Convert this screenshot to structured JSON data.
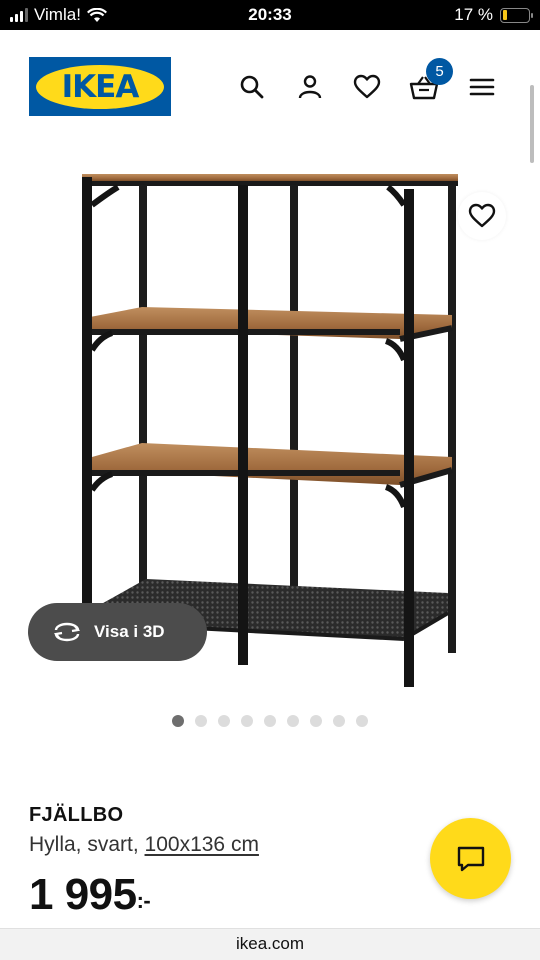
{
  "status_bar": {
    "carrier": "Vimla!",
    "time": "20:33",
    "battery": "17 %",
    "battery_level": 0.17
  },
  "header": {
    "logo_text": "IKEA",
    "cart_count": "5",
    "icons": [
      "search-icon",
      "account-icon",
      "heart-icon",
      "basket-icon",
      "menu-icon"
    ]
  },
  "gallery": {
    "view_3d_label": "Visa i 3D",
    "image_count": 9,
    "active_index": 0
  },
  "product": {
    "name": "FJÄLLBO",
    "type": "Hylla, svart,",
    "size": "100x136 cm",
    "price": "1 995",
    "price_suffix": ":-"
  },
  "browser": {
    "url": "ikea.com"
  },
  "colors": {
    "ikea_blue": "#0058a3",
    "ikea_yellow": "#ffda1a",
    "dark_pill": "#4c4c4c"
  }
}
